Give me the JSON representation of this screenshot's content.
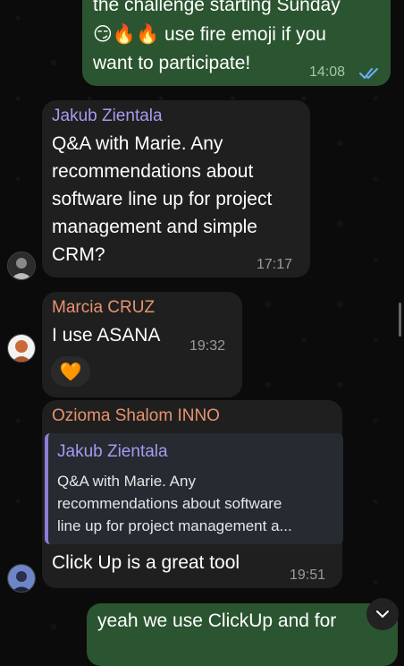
{
  "colors": {
    "outgoing_bubble": "#2b5530",
    "incoming_bubble": "#1f1f1f",
    "sender_jakub": "#a89af0",
    "sender_marcia": "#e8936e",
    "sender_ozioma": "#e8936e",
    "read_ticks": "#6ab0ff"
  },
  "messages": {
    "m1": {
      "line_cut": "the challenge starting Sunday",
      "line2": "😏🔥🔥 use fire emoji if you",
      "line3": "want to participate!",
      "time": "14:08",
      "status_icon": "double-check-icon"
    },
    "m2": {
      "sender": "Jakub Zientala",
      "lines": [
        "Q&A with Marie.  Any",
        "recommendations about",
        "software line up for project",
        "management and simple",
        "CRM?"
      ],
      "time": "17:17"
    },
    "m3": {
      "sender": "Marcia CRUZ",
      "text": "I use ASANA",
      "time": "19:32",
      "reaction": "🧡"
    },
    "m4": {
      "sender": "Ozioma Shalom INNO",
      "quote_sender": "Jakub Zientala",
      "quote_lines": [
        "Q&A with Marie.  Any",
        "recommendations about software",
        "line up for project management a..."
      ],
      "text": "Click Up is a great tool",
      "time": "19:51"
    },
    "m5": {
      "line1": "yeah we use ClickUp and for"
    }
  },
  "scroll_button_icon": "chevron-down-icon"
}
